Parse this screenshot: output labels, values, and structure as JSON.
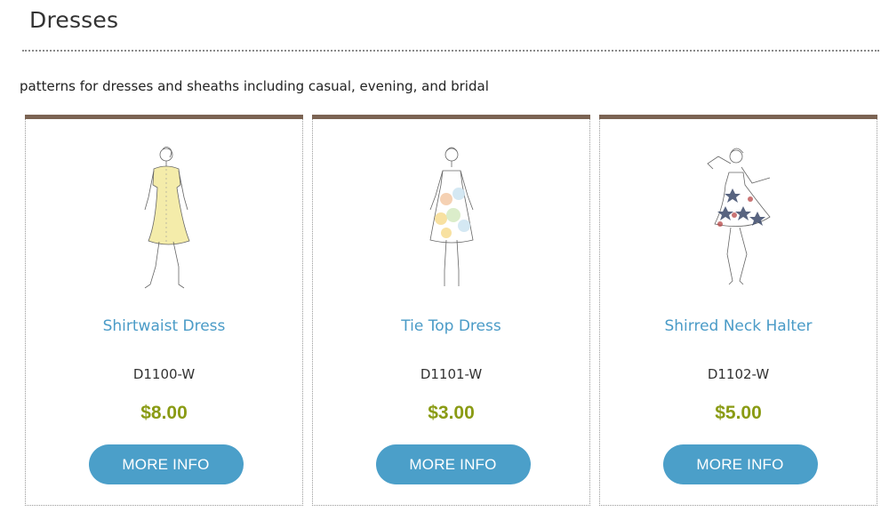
{
  "category": {
    "title": "Dresses",
    "description": "patterns for dresses and sheaths including casual, evening, and bridal"
  },
  "products": [
    {
      "name": "Shirtwaist Dress",
      "sku": "D1100-W",
      "price": "$8.00",
      "button": "MORE INFO",
      "image_icon": "dress-sketch-icon",
      "dress_color": "#f4ecaa"
    },
    {
      "name": "Tie Top Dress",
      "sku": "D1101-W",
      "price": "$3.00",
      "button": "MORE INFO",
      "image_icon": "dress-sketch-icon",
      "dress_color": "#cfe6f2"
    },
    {
      "name": "Shirred Neck Halter",
      "sku": "D1102-W",
      "price": "$5.00",
      "button": "MORE INFO",
      "image_icon": "dress-sketch-icon",
      "dress_color": "#d8dde8"
    }
  ],
  "colors": {
    "card_topbar": "#7b6453",
    "link": "#4a9bc7",
    "price": "#8a9b14",
    "button": "#4b9fc9"
  }
}
